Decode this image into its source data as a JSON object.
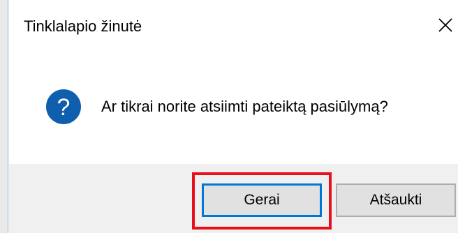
{
  "dialog": {
    "title": "Tinklalapio žinutė",
    "message": "Ar tikrai norite atsiimti pateiktą pasiūlymą?",
    "icon": "question-icon",
    "ok_label": "Gerai",
    "cancel_label": "Atšaukti",
    "close_icon": "close-icon"
  },
  "colors": {
    "icon_blue": "#0f5fae",
    "highlight_red": "#e8101a",
    "default_button_border": "#0078d7",
    "footer_bg": "#f0f0f0"
  }
}
